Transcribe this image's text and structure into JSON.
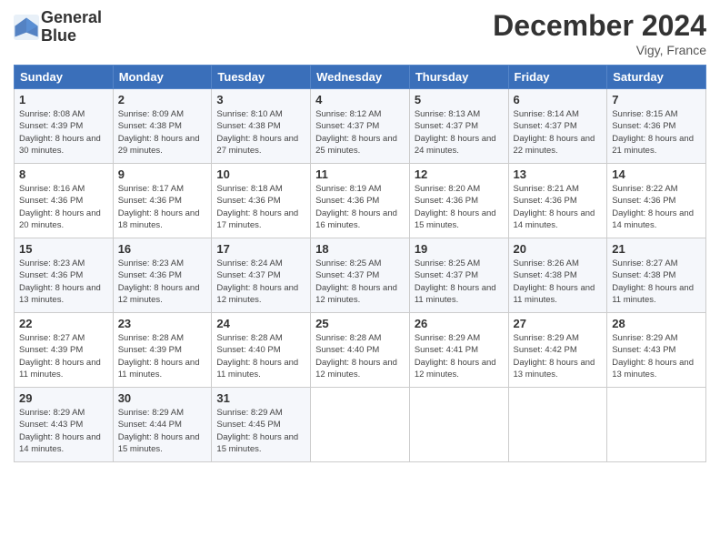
{
  "header": {
    "logo_line1": "General",
    "logo_line2": "Blue",
    "title": "December 2024",
    "location": "Vigy, France"
  },
  "days_of_week": [
    "Sunday",
    "Monday",
    "Tuesday",
    "Wednesday",
    "Thursday",
    "Friday",
    "Saturday"
  ],
  "weeks": [
    [
      {
        "day": "1",
        "sunrise": "8:08 AM",
        "sunset": "4:39 PM",
        "daylight": "8 hours and 30 minutes."
      },
      {
        "day": "2",
        "sunrise": "8:09 AM",
        "sunset": "4:38 PM",
        "daylight": "8 hours and 29 minutes."
      },
      {
        "day": "3",
        "sunrise": "8:10 AM",
        "sunset": "4:38 PM",
        "daylight": "8 hours and 27 minutes."
      },
      {
        "day": "4",
        "sunrise": "8:12 AM",
        "sunset": "4:37 PM",
        "daylight": "8 hours and 25 minutes."
      },
      {
        "day": "5",
        "sunrise": "8:13 AM",
        "sunset": "4:37 PM",
        "daylight": "8 hours and 24 minutes."
      },
      {
        "day": "6",
        "sunrise": "8:14 AM",
        "sunset": "4:37 PM",
        "daylight": "8 hours and 22 minutes."
      },
      {
        "day": "7",
        "sunrise": "8:15 AM",
        "sunset": "4:36 PM",
        "daylight": "8 hours and 21 minutes."
      }
    ],
    [
      {
        "day": "8",
        "sunrise": "8:16 AM",
        "sunset": "4:36 PM",
        "daylight": "8 hours and 20 minutes."
      },
      {
        "day": "9",
        "sunrise": "8:17 AM",
        "sunset": "4:36 PM",
        "daylight": "8 hours and 18 minutes."
      },
      {
        "day": "10",
        "sunrise": "8:18 AM",
        "sunset": "4:36 PM",
        "daylight": "8 hours and 17 minutes."
      },
      {
        "day": "11",
        "sunrise": "8:19 AM",
        "sunset": "4:36 PM",
        "daylight": "8 hours and 16 minutes."
      },
      {
        "day": "12",
        "sunrise": "8:20 AM",
        "sunset": "4:36 PM",
        "daylight": "8 hours and 15 minutes."
      },
      {
        "day": "13",
        "sunrise": "8:21 AM",
        "sunset": "4:36 PM",
        "daylight": "8 hours and 14 minutes."
      },
      {
        "day": "14",
        "sunrise": "8:22 AM",
        "sunset": "4:36 PM",
        "daylight": "8 hours and 14 minutes."
      }
    ],
    [
      {
        "day": "15",
        "sunrise": "8:23 AM",
        "sunset": "4:36 PM",
        "daylight": "8 hours and 13 minutes."
      },
      {
        "day": "16",
        "sunrise": "8:23 AM",
        "sunset": "4:36 PM",
        "daylight": "8 hours and 12 minutes."
      },
      {
        "day": "17",
        "sunrise": "8:24 AM",
        "sunset": "4:37 PM",
        "daylight": "8 hours and 12 minutes."
      },
      {
        "day": "18",
        "sunrise": "8:25 AM",
        "sunset": "4:37 PM",
        "daylight": "8 hours and 12 minutes."
      },
      {
        "day": "19",
        "sunrise": "8:25 AM",
        "sunset": "4:37 PM",
        "daylight": "8 hours and 11 minutes."
      },
      {
        "day": "20",
        "sunrise": "8:26 AM",
        "sunset": "4:38 PM",
        "daylight": "8 hours and 11 minutes."
      },
      {
        "day": "21",
        "sunrise": "8:27 AM",
        "sunset": "4:38 PM",
        "daylight": "8 hours and 11 minutes."
      }
    ],
    [
      {
        "day": "22",
        "sunrise": "8:27 AM",
        "sunset": "4:39 PM",
        "daylight": "8 hours and 11 minutes."
      },
      {
        "day": "23",
        "sunrise": "8:28 AM",
        "sunset": "4:39 PM",
        "daylight": "8 hours and 11 minutes."
      },
      {
        "day": "24",
        "sunrise": "8:28 AM",
        "sunset": "4:40 PM",
        "daylight": "8 hours and 11 minutes."
      },
      {
        "day": "25",
        "sunrise": "8:28 AM",
        "sunset": "4:40 PM",
        "daylight": "8 hours and 12 minutes."
      },
      {
        "day": "26",
        "sunrise": "8:29 AM",
        "sunset": "4:41 PM",
        "daylight": "8 hours and 12 minutes."
      },
      {
        "day": "27",
        "sunrise": "8:29 AM",
        "sunset": "4:42 PM",
        "daylight": "8 hours and 13 minutes."
      },
      {
        "day": "28",
        "sunrise": "8:29 AM",
        "sunset": "4:43 PM",
        "daylight": "8 hours and 13 minutes."
      }
    ],
    [
      {
        "day": "29",
        "sunrise": "8:29 AM",
        "sunset": "4:43 PM",
        "daylight": "8 hours and 14 minutes."
      },
      {
        "day": "30",
        "sunrise": "8:29 AM",
        "sunset": "4:44 PM",
        "daylight": "8 hours and 15 minutes."
      },
      {
        "day": "31",
        "sunrise": "8:29 AM",
        "sunset": "4:45 PM",
        "daylight": "8 hours and 15 minutes."
      },
      null,
      null,
      null,
      null
    ]
  ]
}
